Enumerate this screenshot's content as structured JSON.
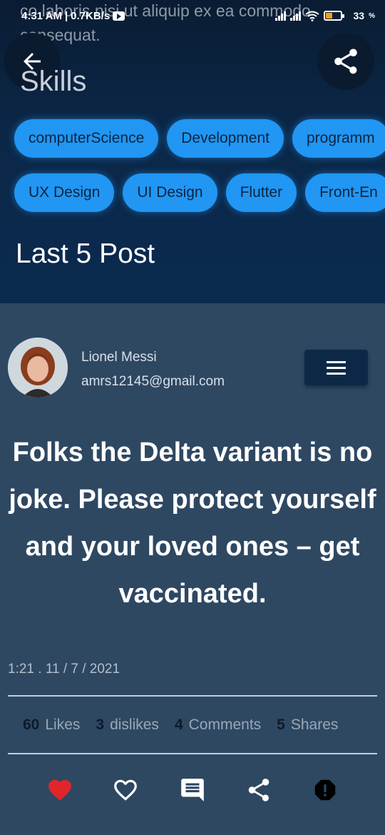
{
  "status_bar": {
    "time": "4:31 AM",
    "speed": "0.7KB/s",
    "battery": "33"
  },
  "background_text": "co laboris nisi ut aliquip ex ea commodo consequat.",
  "icons": {
    "back": "arrow-left-icon",
    "share_top": "share-icon",
    "menu": "hamburger-menu-icon",
    "like": "heart-filled-icon",
    "dislike": "heart-outline-icon",
    "comment": "comment-icon",
    "share": "share-icon",
    "report": "report-icon"
  },
  "skills": {
    "title": "Skills",
    "row1": [
      "computerScience",
      "Development",
      "programm"
    ],
    "row2": [
      "UX Design",
      "UI Design",
      "Flutter",
      "Front-En"
    ]
  },
  "last_posts_title": "Last 5 Post",
  "post": {
    "author_name": "Lionel Messi",
    "author_email": "amrs12145@gmail.com",
    "text": "Folks the Delta variant is no joke. Please protect yourself and your loved ones – get vaccinated.",
    "timestamp": "1:21 . 11 / 7 / 2021",
    "stats": [
      {
        "count": "60",
        "label": "Likes"
      },
      {
        "count": "3",
        "label": "dislikes"
      },
      {
        "count": "4",
        "label": "Comments"
      },
      {
        "count": "5",
        "label": "Shares"
      }
    ]
  },
  "colors": {
    "chip": "#2196f3",
    "header_bg": "#0b2848",
    "post_bg": "#2e4862",
    "like_red": "#e0262a"
  }
}
